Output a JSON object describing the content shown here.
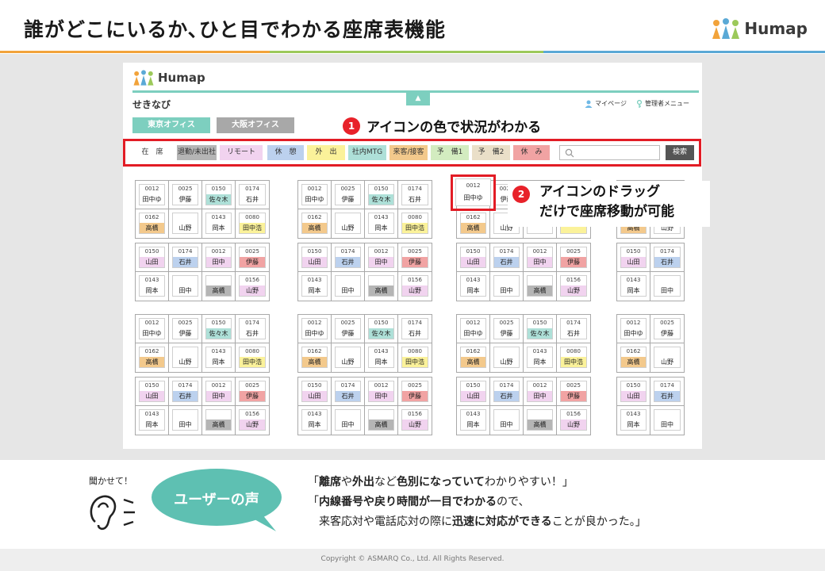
{
  "slide": {
    "title": "誰がどこにいるか､ひと目でわかる座席表機能",
    "brand": "Humap"
  },
  "app": {
    "logo": "Humap",
    "name": "せきなび",
    "tab_icon": "▲",
    "my_page": "マイページ",
    "admin_menu": "管理者メニュー",
    "offices": [
      {
        "label": "東京オフィス",
        "color": "#7dcfbf"
      },
      {
        "label": "大阪オフィス",
        "color": "#a8a8a8"
      }
    ],
    "statuses": [
      {
        "label": "在　席",
        "color": "#ffffff"
      },
      {
        "label": "退勤/未出社",
        "color": "#b5b5b5"
      },
      {
        "label": "リモート",
        "color": "#f1d3ef"
      },
      {
        "label": "休　憩",
        "color": "#bcd1ee"
      },
      {
        "label": "外　出",
        "color": "#fbf29a"
      },
      {
        "label": "社内MTG",
        "color": "#aee0d8"
      },
      {
        "label": "来客/接客",
        "color": "#f3c98c"
      },
      {
        "label": "予　備1",
        "color": "#d3ecc0"
      },
      {
        "label": "予　備2",
        "color": "#eadfc8"
      },
      {
        "label": "休　み",
        "color": "#f1a3a3"
      }
    ],
    "search_placeholder": "",
    "search_button": "検索"
  },
  "callouts": {
    "one_num": "1",
    "one_text": "アイコンの色で状況がわかる",
    "two_num": "2",
    "two_line1": "アイコンのドラッグ",
    "two_line2": "だけで座席移動が可能"
  },
  "pod_templates": {
    "a": [
      {
        "num": "0012",
        "name": "田中ゆ",
        "status": "在　席"
      },
      {
        "num": "0025",
        "name": "伊藤",
        "status": "在　席"
      },
      {
        "num": "0150",
        "name": "佐々木",
        "status": "社内MTG"
      },
      {
        "num": "0174",
        "name": "石井",
        "status": "在　席"
      },
      {
        "num": "0162",
        "name": "高橋",
        "status": "来客/接客"
      },
      {
        "num": "",
        "name": "山野",
        "status": "在　席"
      },
      {
        "num": "0143",
        "name": "岡本",
        "status": "在　席"
      },
      {
        "num": "0080",
        "name": "田中浩",
        "status": "外　出"
      }
    ],
    "b": [
      {
        "num": "0150",
        "name": "山田",
        "status": "リモート"
      },
      {
        "num": "0174",
        "name": "石井",
        "status": "休　憩"
      },
      {
        "num": "0012",
        "name": "田中",
        "status": "リモート"
      },
      {
        "num": "0025",
        "name": "伊藤",
        "status": "休　み"
      },
      {
        "num": "0143",
        "name": "岡本",
        "status": "在　席"
      },
      {
        "num": "",
        "name": "田中",
        "status": "在　席"
      },
      {
        "num": "",
        "name": "高橋",
        "status": "退勤/未出社"
      },
      {
        "num": "0156",
        "name": "山野",
        "status": "リモート"
      }
    ],
    "a_moved": [
      {
        "num": "0012",
        "name": "田中ゆ",
        "status": "在　席"
      },
      {
        "num": "0025",
        "name": "伊藤",
        "status": "在　席"
      },
      {
        "num": "0150",
        "name": "佐々木",
        "status": "社内MTG"
      },
      {
        "num": "0174",
        "name": "石井",
        "status": "在　席"
      },
      {
        "num": "0162",
        "name": "高橋",
        "status": "来客/接客"
      },
      {
        "num": "",
        "name": "山野",
        "status": "在　席"
      },
      {
        "num": "",
        "name": "",
        "status": "在　席"
      },
      {
        "num": "",
        "name": "",
        "status": "外　出"
      }
    ],
    "a_right": [
      {
        "num": "0012",
        "name": "田中ゆ",
        "status": "在　席"
      },
      {
        "num": "0025",
        "name": "伊藤",
        "status": "在　席"
      },
      {
        "num": "",
        "name": "",
        "status": "none"
      },
      {
        "num": "",
        "name": "",
        "status": "none"
      },
      {
        "num": "0162",
        "name": "高橋",
        "status": "来客/接客"
      },
      {
        "num": "",
        "name": "山野",
        "status": "在　席"
      },
      {
        "num": "",
        "name": "",
        "status": "none"
      },
      {
        "num": "",
        "name": "",
        "status": "none"
      }
    ],
    "a_right_top": [
      {
        "num": "",
        "name": "",
        "status": "none"
      },
      {
        "num": "",
        "name": "",
        "status": "none"
      },
      {
        "num": "",
        "name": "",
        "status": "none"
      },
      {
        "num": "",
        "name": "",
        "status": "none"
      },
      {
        "num": "",
        "name": "高橋",
        "status": "来客/接客"
      },
      {
        "num": "",
        "name": "山野",
        "status": "在　席"
      },
      {
        "num": "",
        "name": "",
        "status": "none"
      },
      {
        "num": "",
        "name": "",
        "status": "none"
      }
    ],
    "b_right": [
      {
        "num": "0150",
        "name": "山田",
        "status": "リモート"
      },
      {
        "num": "0174",
        "name": "石井",
        "status": "休　憩"
      },
      {
        "num": "",
        "name": "",
        "status": "none"
      },
      {
        "num": "",
        "name": "",
        "status": "none"
      },
      {
        "num": "0143",
        "name": "岡本",
        "status": "在　席"
      },
      {
        "num": "",
        "name": "田中",
        "status": "在　席"
      },
      {
        "num": "",
        "name": "",
        "status": "none"
      },
      {
        "num": "",
        "name": "",
        "status": "none"
      }
    ]
  },
  "pods": [
    {
      "template": "a",
      "col": 0,
      "row": 0
    },
    {
      "template": "a",
      "col": 1,
      "row": 0
    },
    {
      "template": "a_moved",
      "col": 2,
      "row": 0
    },
    {
      "template": "a_right_top",
      "col": 3,
      "row": 0
    },
    {
      "template": "b",
      "col": 0,
      "row": 1
    },
    {
      "template": "b",
      "col": 1,
      "row": 1
    },
    {
      "template": "b",
      "col": 2,
      "row": 1
    },
    {
      "template": "b_right",
      "col": 3,
      "row": 1
    },
    {
      "template": "a",
      "col": 0,
      "row": 2
    },
    {
      "template": "a",
      "col": 1,
      "row": 2
    },
    {
      "template": "a",
      "col": 2,
      "row": 2
    },
    {
      "template": "a_right",
      "col": 3,
      "row": 2
    },
    {
      "template": "b",
      "col": 0,
      "row": 3
    },
    {
      "template": "b",
      "col": 1,
      "row": 3
    },
    {
      "template": "b",
      "col": 2,
      "row": 3
    },
    {
      "template": "b_right",
      "col": 3,
      "row": 3
    }
  ],
  "dragged_seat": {
    "num": "0012",
    "name": "田中ゆ"
  },
  "voice": {
    "listen_label": "聞かせて！",
    "bubble": "ユーザーの声",
    "q1_a": "「",
    "q1_b": "離席",
    "q1_c": "や",
    "q1_d": "外出",
    "q1_e": "など",
    "q1_f": "色別になっていて",
    "q1_g": "わかりやすい！」",
    "q2_a": "「",
    "q2_b": "内線番号や戻り時間が一目でわかる",
    "q2_c": "ので、",
    "q3_a": "来客応対や電話応対の際に",
    "q3_b": "迅速に対応ができる",
    "q3_c": "ことが良かった。」"
  },
  "footer": {
    "copyright": "Copyright © ASMARQ Co., Ltd. All Rights Reserved."
  },
  "colors": {
    "accent_teal": "#7dcfbf",
    "alert_red": "#e21c25",
    "rule_orange": "#f2a33a",
    "rule_green": "#9cc95a",
    "rule_blue": "#5aa9d6"
  }
}
